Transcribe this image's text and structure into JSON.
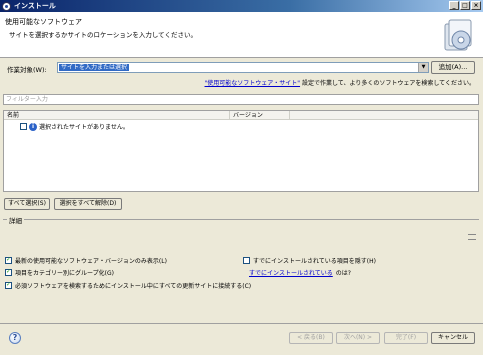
{
  "window": {
    "title": "インストール",
    "controls": [
      "_",
      "□",
      "×"
    ]
  },
  "header": {
    "title": "使用可能なソフトウェア",
    "description": "サイトを選択するかサイトのロケーションを入力してください。"
  },
  "work_with": {
    "label": "作業対象(W):",
    "value": "サイトを入力または選択",
    "add_button": "追加(A)..."
  },
  "hint": {
    "link": "\"使用可能なソフトウェア・サイト\"",
    "text": " 設定で作業して、より多くのソフトウェアを検索してください。"
  },
  "filter": {
    "placeholder": "フィルター入力"
  },
  "table": {
    "columns": [
      "名前",
      "バージョン"
    ],
    "empty_message": "選択されたサイトがありません。"
  },
  "selection_buttons": {
    "select_all": "すべて選択(S)",
    "deselect_all": "選択をすべて解除(D)"
  },
  "details": {
    "label": "詳細"
  },
  "options": {
    "latest_only": "最新の使用可能なソフトウェア・バージョンのみ表示(L)",
    "hide_installed": "すでにインストールされている項目を隠す(H)",
    "group_by_category": "項目をカテゴリー別にグループ化(G)",
    "already_installed_link": "すでにインストールされている",
    "already_installed_suffix": "のは?",
    "contact_all_sites": "必須ソフトウェアを検索するためにインストール中にすべての更新サイトに接続する(C)"
  },
  "footer": {
    "back": "< 戻る(B)",
    "next": "次へ(N) >",
    "finish": "完了(F)",
    "cancel": "キャンセル"
  }
}
